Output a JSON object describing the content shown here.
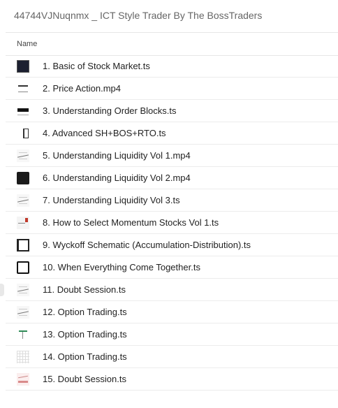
{
  "window": {
    "title": "44744VJNuqnmx _ ICT Style Trader By The BossTraders"
  },
  "table": {
    "column_name": "Name"
  },
  "files": [
    {
      "name": "1. Basic of Stock Market.ts",
      "thumb": "t-dark",
      "icon": "video-thumbnail-icon"
    },
    {
      "name": "2. Price Action.mp4",
      "thumb": "t-lines",
      "icon": "video-thumbnail-icon"
    },
    {
      "name": "3. Understanding Order Blocks.ts",
      "thumb": "t-bar",
      "icon": "video-thumbnail-icon"
    },
    {
      "name": "4. Advanced SH+BOS+RTO.ts",
      "thumb": "t-glyph",
      "icon": "video-thumbnail-icon"
    },
    {
      "name": "5. Understanding Liquidity Vol 1.mp4",
      "thumb": "t-chart",
      "icon": "video-thumbnail-icon"
    },
    {
      "name": "6. Understanding Liquidity Vol 2.mp4",
      "thumb": "t-dark2",
      "icon": "video-thumbnail-icon"
    },
    {
      "name": "7. Understanding Liquidity Vol 3.ts",
      "thumb": "t-chart",
      "icon": "video-thumbnail-icon"
    },
    {
      "name": "8. How to Select Momentum Stocks Vol 1.ts",
      "thumb": "t-red",
      "icon": "video-thumbnail-icon"
    },
    {
      "name": "9. Wyckoff Schematic (Accumulation-Distribution).ts",
      "thumb": "t-frame",
      "icon": "video-thumbnail-icon"
    },
    {
      "name": "10. When Everything Come Together.ts",
      "thumb": "t-dark3",
      "icon": "video-thumbnail-icon"
    },
    {
      "name": "11. Doubt Session.ts",
      "thumb": "t-chart",
      "icon": "video-thumbnail-icon"
    },
    {
      "name": "12. Option Trading.ts",
      "thumb": "t-chart",
      "icon": "video-thumbnail-icon"
    },
    {
      "name": "13. Option Trading.ts",
      "thumb": "t-green",
      "icon": "video-thumbnail-icon"
    },
    {
      "name": "14. Option Trading.ts",
      "thumb": "t-grid",
      "icon": "video-thumbnail-icon"
    },
    {
      "name": "15. Doubt Session.ts",
      "thumb": "t-pink",
      "icon": "video-thumbnail-icon"
    }
  ]
}
